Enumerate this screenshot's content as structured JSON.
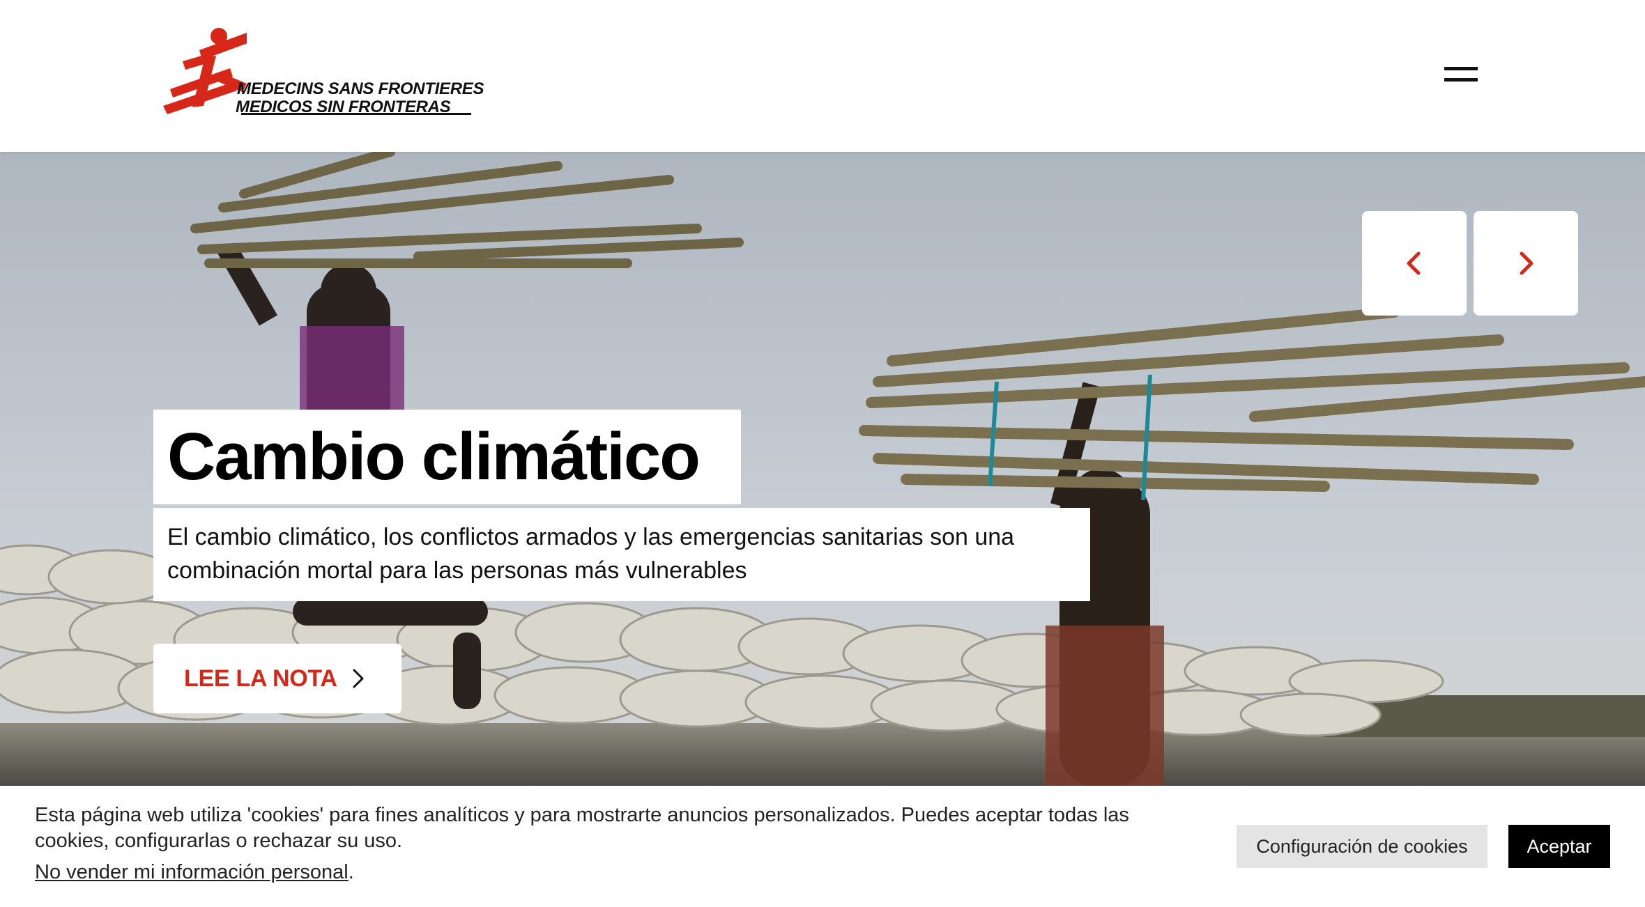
{
  "header": {
    "logo": {
      "line1": "MEDECINS SANS FRONTIERES",
      "line2": "MEDICOS SIN FRONTERAS",
      "icon": "msf-running-man-logo"
    },
    "menu_icon": "hamburger-menu-icon"
  },
  "hero": {
    "title": "Cambio climático",
    "subtitle": "El cambio climático, los conflictos armados y las emergencias sanitarias son una combinación mortal para las personas más vulnerables",
    "cta_label": "LEE LA NOTA",
    "cta_icon": "chevron-right-icon",
    "prev_icon": "chevron-left-icon",
    "next_icon": "chevron-right-icon"
  },
  "cookie_bar": {
    "text": "Esta página web utiliza 'cookies' para fines analíticos y para mostrarte anuncios personalizados. Puedes aceptar todas las cookies, configurarlas o rechazar su uso.",
    "link_text": "No vender mi información personal",
    "link_suffix": ".",
    "config_label": "Configuración de cookies",
    "accept_label": "Aceptar"
  },
  "colors": {
    "brand_red": "#d62718",
    "text_black": "#111111",
    "accept_bg": "#000000",
    "config_bg": "#e4e4e4"
  }
}
